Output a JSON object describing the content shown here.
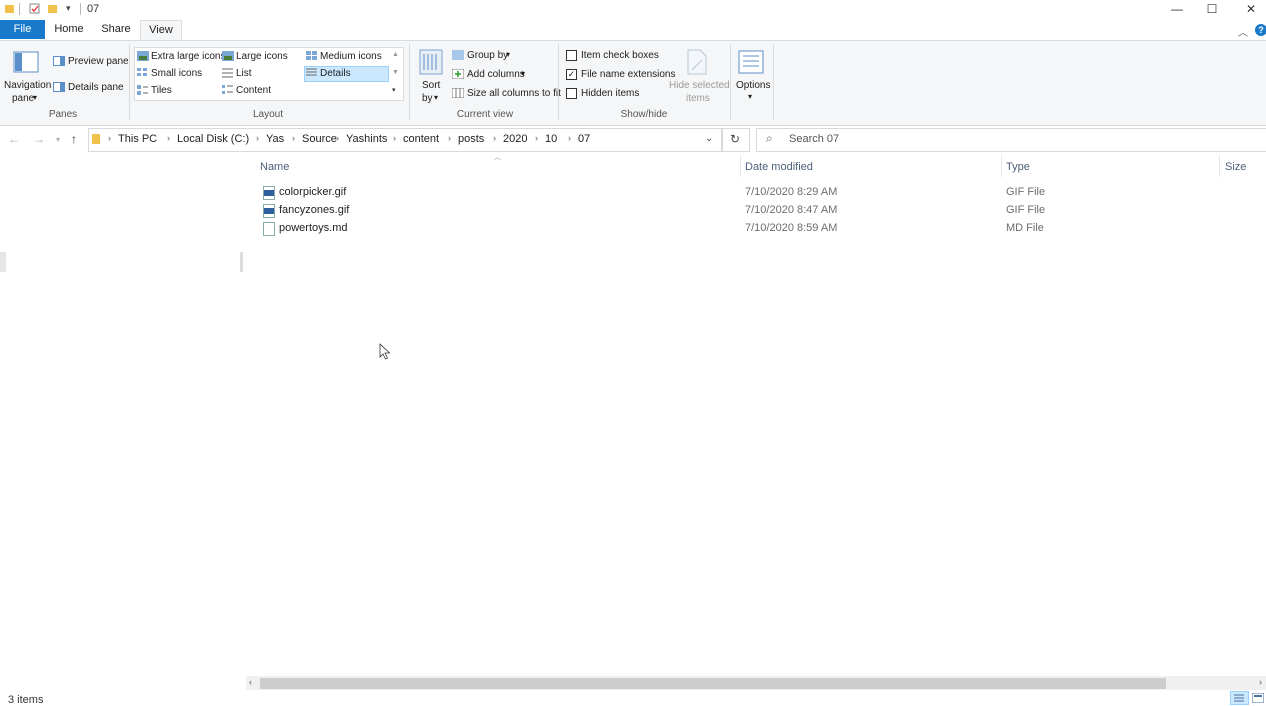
{
  "window": {
    "title": "07",
    "controls": {
      "minimize": "—",
      "maximize": "☐",
      "close": "✕"
    }
  },
  "tabs": {
    "file": "File",
    "home": "Home",
    "share": "Share",
    "view": "View"
  },
  "ribbon": {
    "panes": {
      "navigation_pane": "Navigation",
      "navigation_pane2": "pane",
      "preview_pane": "Preview pane",
      "details_pane": "Details pane",
      "group_label": "Panes"
    },
    "layout": {
      "extra_large_icons": "Extra large icons",
      "large_icons": "Large icons",
      "medium_icons": "Medium icons",
      "small_icons": "Small icons",
      "list": "List",
      "details": "Details",
      "tiles": "Tiles",
      "content": "Content",
      "group_label": "Layout",
      "selected": "Details"
    },
    "current_view": {
      "sort_by": "Sort",
      "sort_by2": "by",
      "group_by": "Group by",
      "add_columns": "Add columns",
      "size_all_columns": "Size all columns to fit",
      "group_label": "Current view"
    },
    "show_hide": {
      "item_check_boxes": "Item check boxes",
      "file_name_extensions": "File name extensions",
      "hidden_items": "Hidden items",
      "hide_selected_items": "Hide selected",
      "hide_selected_items2": "items",
      "group_label": "Show/hide",
      "file_name_extensions_checked": true,
      "item_check_boxes_checked": false,
      "hidden_items_checked": false
    },
    "options": {
      "label": "Options"
    }
  },
  "address": {
    "crumbs": [
      "This PC",
      "Local Disk (C:)",
      "Yas",
      "Source",
      "Yashints",
      "content",
      "posts",
      "2020",
      "10",
      "07"
    ]
  },
  "search": {
    "placeholder": "Search 07"
  },
  "columns": {
    "name": "Name",
    "date": "Date modified",
    "type": "Type",
    "size": "Size"
  },
  "files": [
    {
      "name": "colorpicker.gif",
      "date": "7/10/2020 8:29 AM",
      "type": "GIF File",
      "icon": "gif-file-icon"
    },
    {
      "name": "fancyzones.gif",
      "date": "7/10/2020 8:47 AM",
      "type": "GIF File",
      "icon": "gif-file-icon"
    },
    {
      "name": "powertoys.md",
      "date": "7/10/2020 8:59 AM",
      "type": "MD File",
      "icon": "text-file-icon"
    }
  ],
  "status": {
    "items": "3 items"
  },
  "colors": {
    "accent": "#1979ca",
    "ribbon": "#f5f6f7",
    "selected": "#cce8ff"
  }
}
